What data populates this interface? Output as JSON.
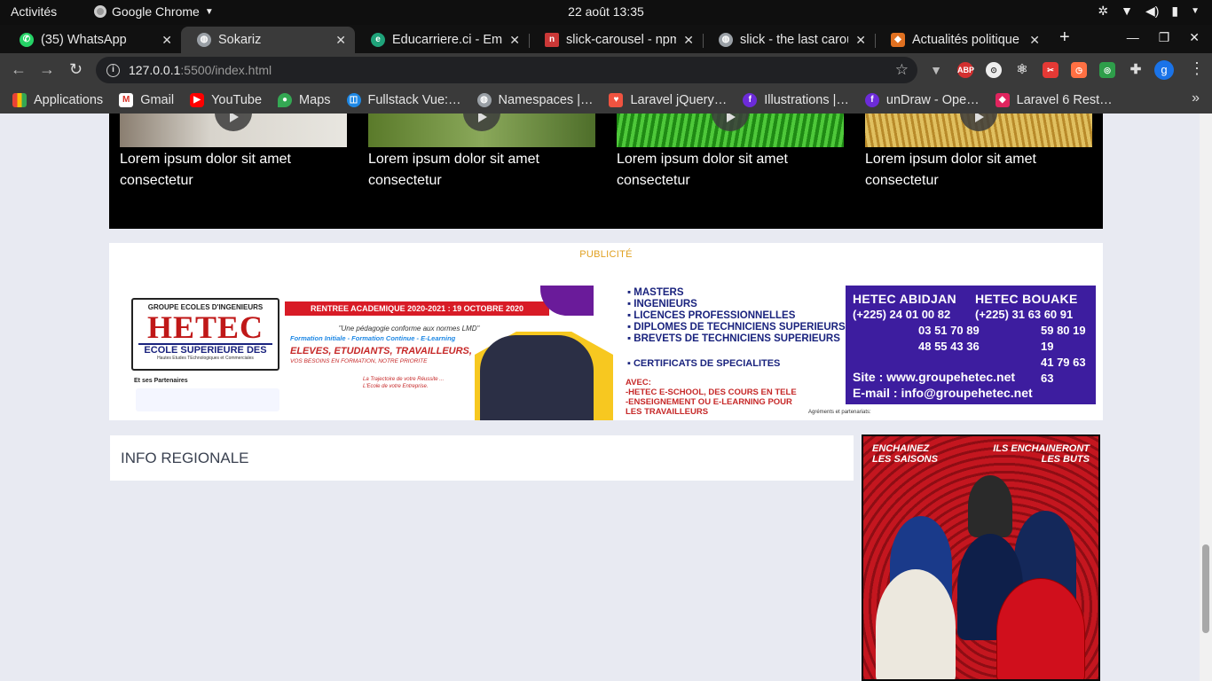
{
  "topbar": {
    "activities": "Activités",
    "app_name": "Google Chrome",
    "clock": "22 août  13:35"
  },
  "tabs": [
    {
      "title": "(35) WhatsApp",
      "icon": "whatsapp-icon",
      "color": "#25d366"
    },
    {
      "title": "Sokariz",
      "icon": "globe-icon",
      "color": "#9aa0a6",
      "active": true
    },
    {
      "title": "Educarriere.ci - Emp",
      "icon": "educarriere-icon",
      "color": "#1fa37a"
    },
    {
      "title": "slick-carousel - npm",
      "icon": "npm-icon",
      "color": "#cb3837"
    },
    {
      "title": "slick - the last carou",
      "icon": "globe-icon",
      "color": "#9aa0a6"
    },
    {
      "title": "Actualités politique",
      "icon": "news-icon",
      "color": "#e07020"
    }
  ],
  "address_bar": {
    "host": "127.0.0.1",
    "path": ":5500/index.html"
  },
  "bookmarks": [
    {
      "label": "Applications",
      "icon": "apps-grid-icon",
      "color": "#e94235"
    },
    {
      "label": "Gmail",
      "icon": "gmail-icon",
      "color": "#d93025"
    },
    {
      "label": "YouTube",
      "icon": "youtube-icon",
      "color": "#ff0000"
    },
    {
      "label": "Maps",
      "icon": "maps-icon",
      "color": "#34a853"
    },
    {
      "label": "Fullstack Vue:…",
      "icon": "vue-icon",
      "color": "#1e88e5"
    },
    {
      "label": "Namespaces |…",
      "icon": "globe-icon",
      "color": "#9aa0a6"
    },
    {
      "label": "Laravel jQuery…",
      "icon": "laravel-icon",
      "color": "#f05340"
    },
    {
      "label": "Illustrations |…",
      "icon": "undraw-icon",
      "color": "#6c2bd9"
    },
    {
      "label": "unDraw - Ope…",
      "icon": "undraw-icon",
      "color": "#6c2bd9"
    },
    {
      "label": "Laravel 6 Rest…",
      "icon": "laravel-icon",
      "color": "#e0245e"
    }
  ],
  "videos": [
    {
      "caption_line1": "Lorem ipsum dolor sit amet",
      "caption_line2": "consectetur",
      "thumb_color": "#b8b4a8"
    },
    {
      "caption_line1": "Lorem ipsum dolor sit amet",
      "caption_line2": "consectetur",
      "thumb_color": "#6a8a3a"
    },
    {
      "caption_line1": "Lorem ipsum dolor sit amet",
      "caption_line2": "consectetur",
      "thumb_color": "#2fa51f"
    },
    {
      "caption_line1": "Lorem ipsum dolor sit amet",
      "caption_line2": "consectetur",
      "thumb_color": "#c9a23a"
    }
  ],
  "ad": {
    "label": "PUBLICITÉ",
    "banner": {
      "group": "GROUPE ECOLES D'INGENIEURS",
      "brand": "HETEC",
      "school": "ECOLE SUPERIEURE DES",
      "school_sub": "Hautes Etudes TEchnologiques et Commerciales",
      "partners_label": "Et ses Partenaires",
      "rentree": "RENTREE ACADEMIQUE 2020-2021 : 19 OCTOBRE 2020",
      "pedagogie": "\"Une pédagogie conforme aux normes LMD\"",
      "formation": "Formation Initiale - Formation Continue - E-Learning",
      "eleves": "ELEVES, ETUDIANTS, TRAVAILLEURS,",
      "besoins": "VOS BESOINS EN FORMATION, NOTRE PRIORITE",
      "trajet_1": "La Trajectoire de votre Réussite ...",
      "trajet_2": "L'Ecole de votre Entreprise.",
      "courses": [
        "MASTERS",
        "INGENIEURS",
        "LICENCES PROFESSIONNELLES",
        "DIPLOMES DE TECHNICIENS SUPERIEURS",
        "BREVETS DE TECHNICIENS SUPERIEURS"
      ],
      "certificats": "CERTIFICATS DE SPECIALITES",
      "avec_1": "AVEC:",
      "avec_2": "-HETEC E-SCHOOL, DES COURS EN TELE",
      "avec_3": "-ENSEIGNEMENT OU E-LEARNING POUR",
      "avec_4": "LES TRAVAILLEURS",
      "agrements": "Agréments et partenariats:",
      "abidjan_title": "HETEC ABIDJAN",
      "abidjan_1": "(+225) 24 01 00 82",
      "abidjan_2": "03 51 70 89",
      "abidjan_3": "48 55 43 36",
      "bouake_title": "HETEC BOUAKE",
      "bouake_1": "(+225) 31 63 60 91",
      "bouake_2": "59 80 19 19",
      "bouake_3": "41 79 63 63",
      "site": "Site : www.groupehetec.net",
      "email": "E-mail : info@groupehetec.net"
    }
  },
  "info_regionale": "INFO REGIONALE",
  "side_ad": {
    "left_1": "ENCHAINEZ",
    "left_2": "LES SAISONS",
    "right_1": "ILS ENCHAINERONT",
    "right_2": "LES BUTS"
  }
}
